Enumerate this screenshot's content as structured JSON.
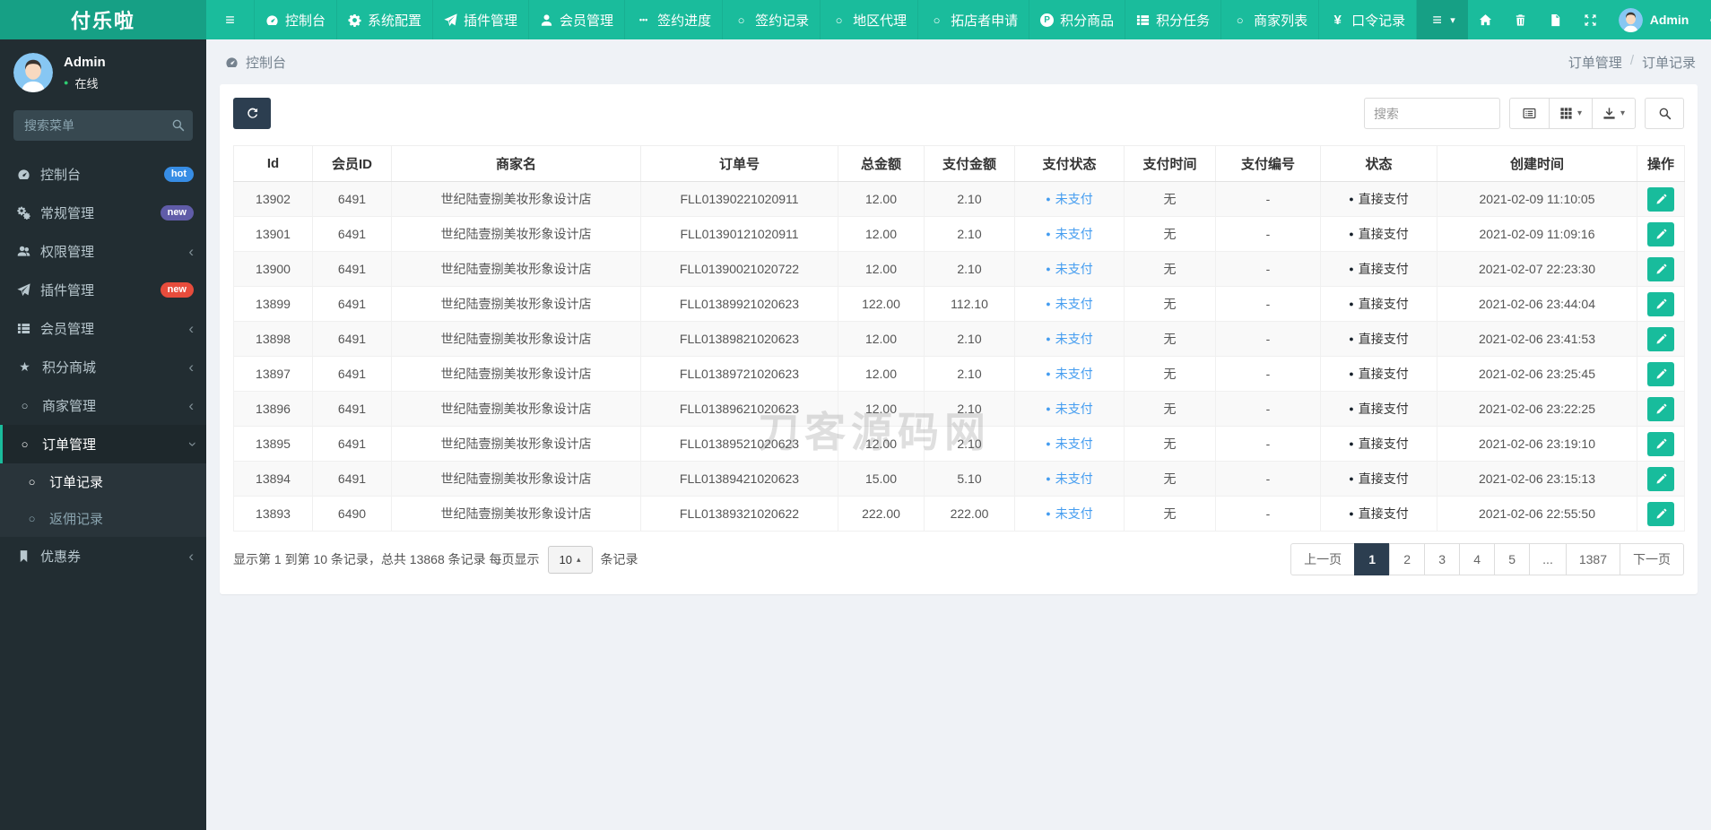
{
  "navbar": {
    "brand": "付乐啦",
    "username": "Admin",
    "items": [
      {
        "name": "dashboard",
        "label": "控制台",
        "icon": "dashboard"
      },
      {
        "name": "system-config",
        "label": "系统配置",
        "icon": "gear"
      },
      {
        "name": "plugin-management",
        "label": "插件管理",
        "icon": "paper-plane"
      },
      {
        "name": "member-management",
        "label": "会员管理",
        "icon": "user"
      },
      {
        "name": "sign-progress",
        "label": "签约进度",
        "icon": "ellipsis"
      },
      {
        "name": "sign-records",
        "label": "签约记录",
        "icon": "circle"
      },
      {
        "name": "region-agents",
        "label": "地区代理",
        "icon": "circle"
      },
      {
        "name": "store-applications",
        "label": "拓店者申请",
        "icon": "circle"
      },
      {
        "name": "points-goods",
        "label": "积分商品",
        "icon": "p-circle"
      },
      {
        "name": "points-tasks",
        "label": "积分任务",
        "icon": "th-list"
      },
      {
        "name": "merchant-list",
        "label": "商家列表",
        "icon": "circle"
      },
      {
        "name": "password-records",
        "label": "口令记录",
        "icon": "yen"
      }
    ]
  },
  "sidebar": {
    "username": "Admin",
    "status_label": "在线",
    "search_placeholder": "搜索菜单",
    "menu": [
      {
        "name": "dashboard",
        "label": "控制台",
        "icon": "dashboard",
        "badge": {
          "text": "hot",
          "color": "#378de5"
        }
      },
      {
        "name": "general",
        "label": "常规管理",
        "icon": "gears",
        "badge": {
          "text": "new",
          "color": "#605ca8"
        }
      },
      {
        "name": "auth",
        "label": "权限管理",
        "icon": "users",
        "chevron": "left"
      },
      {
        "name": "addons",
        "label": "插件管理",
        "icon": "paper-plane",
        "badge": {
          "text": "new",
          "color": "#e74c3c"
        }
      },
      {
        "name": "members",
        "label": "会员管理",
        "icon": "th-list",
        "chevron": "left"
      },
      {
        "name": "points-mall",
        "label": "积分商城",
        "icon": "star",
        "chevron": "left"
      },
      {
        "name": "merchants",
        "label": "商家管理",
        "icon": "circle",
        "chevron": "left"
      },
      {
        "name": "orders",
        "label": "订单管理",
        "icon": "circle",
        "chevron": "down",
        "active": true,
        "children": [
          {
            "name": "order-records",
            "label": "订单记录",
            "icon": "circle",
            "active": true
          },
          {
            "name": "rebate-records",
            "label": "返佣记录",
            "icon": "circle"
          }
        ]
      },
      {
        "name": "coupons",
        "label": "优惠券",
        "icon": "bookmark",
        "chevron": "left"
      }
    ]
  },
  "breadcrumb": {
    "page": "控制台",
    "trail_parent": "订单管理",
    "trail_sep": "/",
    "trail_current": "订单记录"
  },
  "toolbar": {
    "search_placeholder": "搜索"
  },
  "table": {
    "columns": [
      "Id",
      "会员ID",
      "商家名",
      "订单号",
      "总金额",
      "支付金额",
      "支付状态",
      "支付时间",
      "支付编号",
      "状态",
      "创建时间",
      "操作"
    ],
    "rows": [
      {
        "id": "13902",
        "member_id": "6491",
        "merchant": "世纪陆壹捌美妆形象设计店",
        "order_no": "FLL01390221020911",
        "total": "12.00",
        "paid": "2.10",
        "pay_status": "未支付",
        "pay_time": "无",
        "pay_no": "-",
        "status": "直接支付",
        "created": "2021-02-09 11:10:05"
      },
      {
        "id": "13901",
        "member_id": "6491",
        "merchant": "世纪陆壹捌美妆形象设计店",
        "order_no": "FLL01390121020911",
        "total": "12.00",
        "paid": "2.10",
        "pay_status": "未支付",
        "pay_time": "无",
        "pay_no": "-",
        "status": "直接支付",
        "created": "2021-02-09 11:09:16"
      },
      {
        "id": "13900",
        "member_id": "6491",
        "merchant": "世纪陆壹捌美妆形象设计店",
        "order_no": "FLL01390021020722",
        "total": "12.00",
        "paid": "2.10",
        "pay_status": "未支付",
        "pay_time": "无",
        "pay_no": "-",
        "status": "直接支付",
        "created": "2021-02-07 22:23:30"
      },
      {
        "id": "13899",
        "member_id": "6491",
        "merchant": "世纪陆壹捌美妆形象设计店",
        "order_no": "FLL01389921020623",
        "total": "122.00",
        "paid": "112.10",
        "pay_status": "未支付",
        "pay_time": "无",
        "pay_no": "-",
        "status": "直接支付",
        "created": "2021-02-06 23:44:04"
      },
      {
        "id": "13898",
        "member_id": "6491",
        "merchant": "世纪陆壹捌美妆形象设计店",
        "order_no": "FLL01389821020623",
        "total": "12.00",
        "paid": "2.10",
        "pay_status": "未支付",
        "pay_time": "无",
        "pay_no": "-",
        "status": "直接支付",
        "created": "2021-02-06 23:41:53"
      },
      {
        "id": "13897",
        "member_id": "6491",
        "merchant": "世纪陆壹捌美妆形象设计店",
        "order_no": "FLL01389721020623",
        "total": "12.00",
        "paid": "2.10",
        "pay_status": "未支付",
        "pay_time": "无",
        "pay_no": "-",
        "status": "直接支付",
        "created": "2021-02-06 23:25:45"
      },
      {
        "id": "13896",
        "member_id": "6491",
        "merchant": "世纪陆壹捌美妆形象设计店",
        "order_no": "FLL01389621020623",
        "total": "12.00",
        "paid": "2.10",
        "pay_status": "未支付",
        "pay_time": "无",
        "pay_no": "-",
        "status": "直接支付",
        "created": "2021-02-06 23:22:25"
      },
      {
        "id": "13895",
        "member_id": "6491",
        "merchant": "世纪陆壹捌美妆形象设计店",
        "order_no": "FLL01389521020623",
        "total": "12.00",
        "paid": "2.10",
        "pay_status": "未支付",
        "pay_time": "无",
        "pay_no": "-",
        "status": "直接支付",
        "created": "2021-02-06 23:19:10"
      },
      {
        "id": "13894",
        "member_id": "6491",
        "merchant": "世纪陆壹捌美妆形象设计店",
        "order_no": "FLL01389421020623",
        "total": "15.00",
        "paid": "5.10",
        "pay_status": "未支付",
        "pay_time": "无",
        "pay_no": "-",
        "status": "直接支付",
        "created": "2021-02-06 23:15:13"
      },
      {
        "id": "13893",
        "member_id": "6490",
        "merchant": "世纪陆壹捌美妆形象设计店",
        "order_no": "FLL01389321020622",
        "total": "222.00",
        "paid": "222.00",
        "pay_status": "未支付",
        "pay_time": "无",
        "pay_no": "-",
        "status": "直接支付",
        "created": "2021-02-06 22:55:50"
      }
    ]
  },
  "pagination": {
    "info_prefix": "显示第 1 到第 10 条记录，总共 13868 条记录 每页显示",
    "info_suffix": "条记录",
    "page_size": "10",
    "prev_label": "上一页",
    "next_label": "下一页",
    "pages": [
      "1",
      "2",
      "3",
      "4",
      "5",
      "...",
      "1387"
    ],
    "active_page": "1"
  },
  "watermark": "刀客源码网",
  "colors": {
    "navbar_teal": "#1abc9c",
    "logo_teal": "#16a085",
    "sidebar_dark": "#222d32",
    "primary_dark": "#2c3e50",
    "unpaid_blue": "#459df0",
    "edit_green": "#18bc9c",
    "online_green": "#2ecc71"
  }
}
